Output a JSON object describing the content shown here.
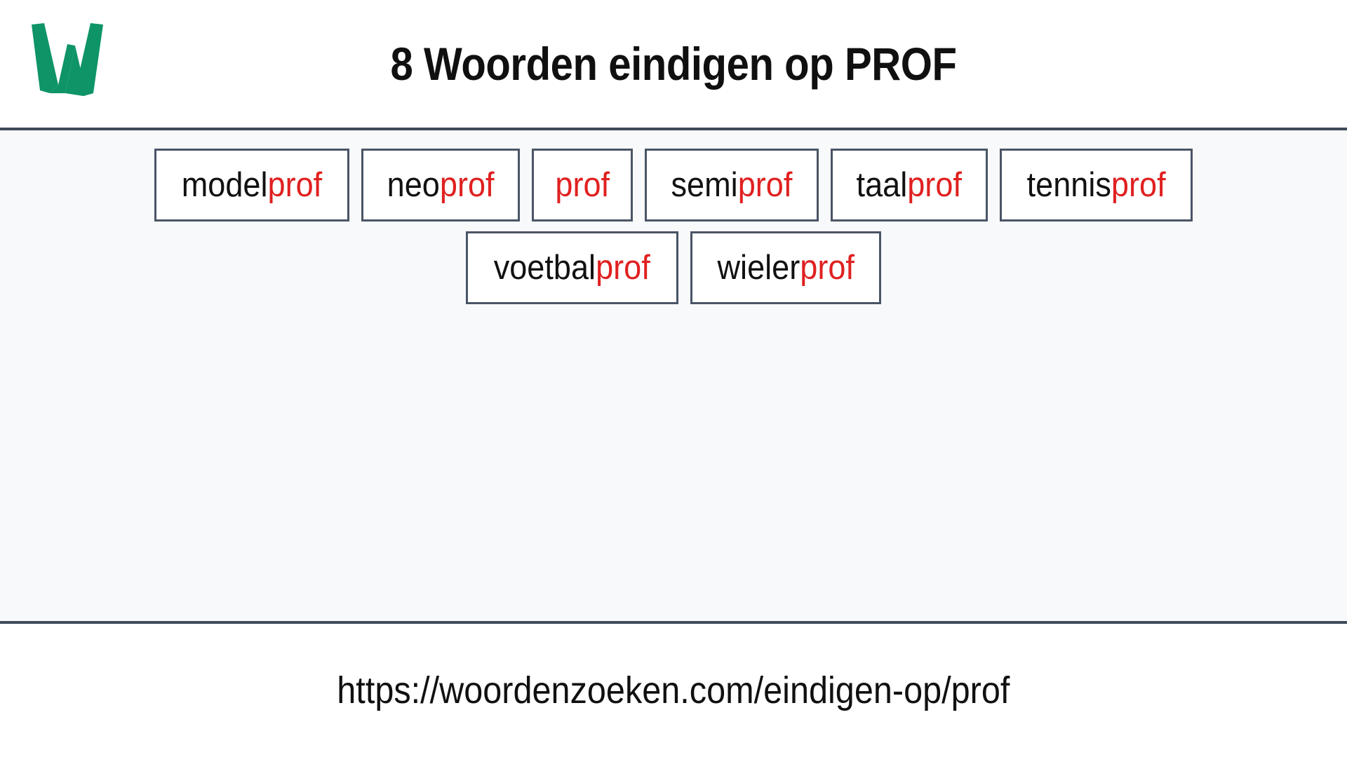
{
  "header": {
    "logo_letter": "W",
    "logo_color": "#0e9467",
    "title": "8 Woorden eindigen op PROF"
  },
  "theme": {
    "page_background": "#ffffff",
    "content_background": "#f7f9fb",
    "divider_color": "#3f4a5a",
    "box_border_color": "#4a5566",
    "text_color": "#111111",
    "suffix_color": "#e02020"
  },
  "main": {
    "suffix": "prof",
    "rows": [
      [
        {
          "prefix": "model",
          "suffix": "prof",
          "full": "modelprof"
        },
        {
          "prefix": "neo",
          "suffix": "prof",
          "full": "neoprof"
        },
        {
          "prefix": "",
          "suffix": "prof",
          "full": "prof"
        },
        {
          "prefix": "semi",
          "suffix": "prof",
          "full": "semiprof"
        },
        {
          "prefix": "taal",
          "suffix": "prof",
          "full": "taalprof"
        },
        {
          "prefix": "tennis",
          "suffix": "prof",
          "full": "tennisprof"
        }
      ],
      [
        {
          "prefix": "voetbal",
          "suffix": "prof",
          "full": "voetbalprof"
        },
        {
          "prefix": "wieler",
          "suffix": "prof",
          "full": "wielerprof"
        }
      ]
    ]
  },
  "footer": {
    "url": "https://woordenzoeken.com/eindigen-op/prof"
  }
}
